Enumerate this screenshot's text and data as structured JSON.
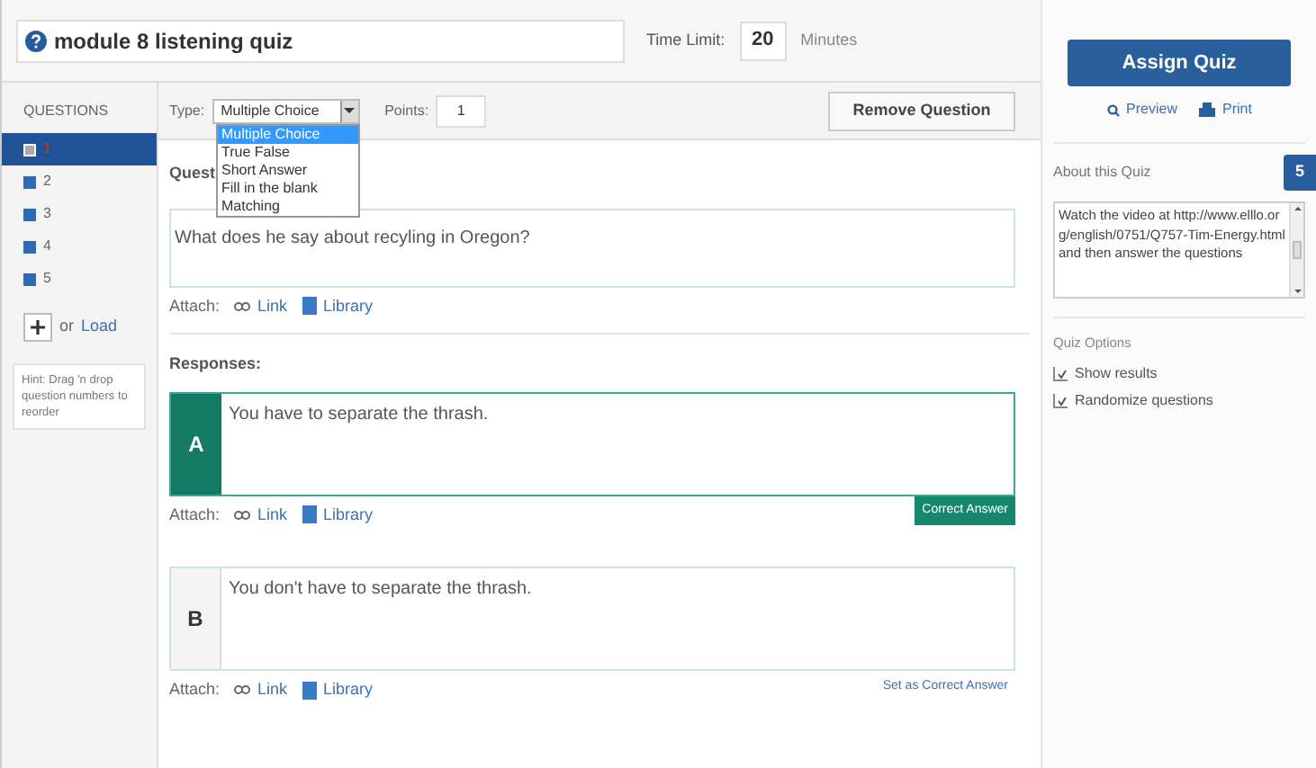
{
  "quiz_title": "module 8 listening quiz",
  "time_limit": {
    "label": "Time Limit:",
    "value": "20",
    "unit": "Minutes"
  },
  "questions": {
    "heading": "QUESTIONS",
    "items": [
      {
        "label": "1",
        "selected": true
      },
      {
        "label": "2",
        "selected": false
      },
      {
        "label": "3",
        "selected": false
      },
      {
        "label": "4",
        "selected": false
      },
      {
        "label": "5",
        "selected": false
      }
    ],
    "add": {
      "or": "or",
      "load": "Load"
    },
    "hint": "Hint: Drag 'n drop question numbers to reorder"
  },
  "editor": {
    "type_label": "Type:",
    "type_value": "Multiple Choice",
    "type_options": [
      {
        "label": "Multiple Choice",
        "selected": true
      },
      {
        "label": "True False",
        "selected": false
      },
      {
        "label": "Short Answer",
        "selected": false
      },
      {
        "label": "Fill in the blank",
        "selected": false
      },
      {
        "label": "Matching",
        "selected": false
      }
    ],
    "expanded": true,
    "points_label": "Points:",
    "points": "1",
    "remove": "Remove Question",
    "question_label": "Quest",
    "question_text": "What does he say about recyling in Oregon?",
    "attach": {
      "label": "Attach:",
      "link": "Link",
      "library": "Library"
    },
    "responses_label": "Responses:",
    "responses": [
      {
        "letter": "A",
        "text": "You have to separate the thrash.",
        "correct": true,
        "action": "Correct Answer",
        "attach": {
          "label": "Attach:",
          "link": "Link",
          "library": "Library"
        }
      },
      {
        "letter": "B",
        "text": "You don't have to separate the thrash.",
        "correct": false,
        "action": "Set as Correct Answer",
        "attach": {
          "label": "Attach:",
          "link": "Link",
          "library": "Library"
        }
      }
    ]
  },
  "sidebar": {
    "assign": "Assign Quiz",
    "preview": "Preview",
    "print": "Print",
    "about_label": "About this Quiz",
    "badge": "5",
    "about_text": "Watch the video at http://www.elllo.org/english/0751/Q757-Tim-Energy.html and then answer the questions",
    "options_label": "Quiz Options",
    "options": [
      {
        "label": "Show results",
        "checked": true
      },
      {
        "label": "Randomize questions",
        "checked": true
      }
    ]
  }
}
